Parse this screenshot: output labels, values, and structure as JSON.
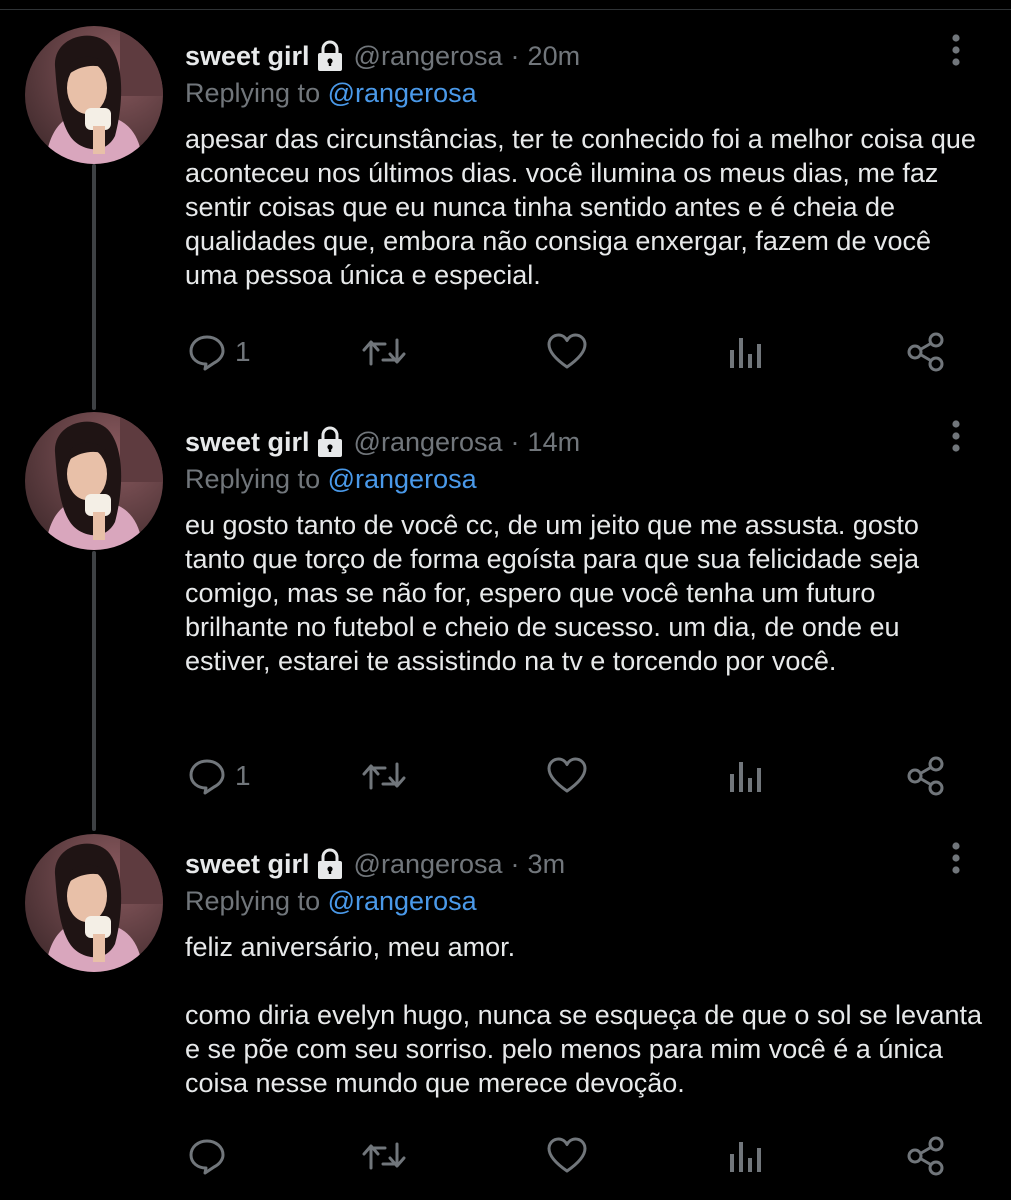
{
  "tweets": [
    {
      "name": "sweet girl",
      "handle": "@rangerosa",
      "separator": "·",
      "time": "20m",
      "replying_prefix": "Replying to",
      "replying_to": "@rangerosa",
      "paragraphs": [
        "apesar das circunstâncias, ter te conhecido foi a melhor coisa que aconteceu nos últimos dias. você ilumina os meus dias, me faz sentir coisas que eu nunca tinha sentido antes e é cheia de qualidades que, embora não consiga enxergar, fazem de você uma pessoa única e especial."
      ],
      "reply_count": "1"
    },
    {
      "name": "sweet girl",
      "handle": "@rangerosa",
      "separator": "·",
      "time": "14m",
      "replying_prefix": "Replying to",
      "replying_to": "@rangerosa",
      "paragraphs": [
        "eu gosto tanto de você cc, de um jeito que me assusta. gosto tanto que torço de forma egoísta para que sua felicidade seja comigo, mas se não for, espero que você tenha um futuro brilhante no futebol e cheio de sucesso. um dia, de onde eu estiver, estarei te assistindo na tv e torcendo por você."
      ],
      "reply_count": "1"
    },
    {
      "name": "sweet girl",
      "handle": "@rangerosa",
      "separator": "·",
      "time": "3m",
      "replying_prefix": "Replying to",
      "replying_to": "@rangerosa",
      "paragraphs": [
        "feliz aniversário, meu amor.",
        "como diria evelyn hugo, nunca se esqueça de que o sol se levanta e se põe com seu sorriso. pelo menos para mim você é a única coisa nesse mundo que merece devoção."
      ],
      "reply_count": ""
    }
  ],
  "icons": {
    "lock": "lock-icon",
    "more": "more-vertical-icon",
    "reply": "reply-icon",
    "retweet": "retweet-icon",
    "like": "heart-icon",
    "analytics": "analytics-icon",
    "share": "share-icon"
  },
  "colors": {
    "background": "#000000",
    "text": "#e7e9ea",
    "muted": "#71767b",
    "mention": "#4a99e9",
    "thread_line": "#3e4144"
  }
}
